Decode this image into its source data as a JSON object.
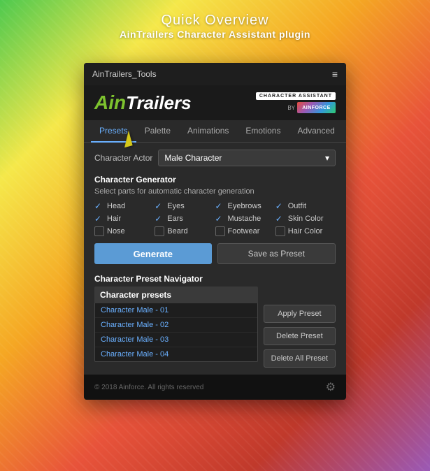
{
  "page": {
    "title": "Quick Overview",
    "subtitle": "AinTrailers Character Assistant plugin"
  },
  "titlebar": {
    "text": "AinTrailers_Tools",
    "menu_icon": "≡"
  },
  "logo": {
    "ain": "Ain",
    "trailers": "Trailers",
    "badge": "CHARACTER ASSISTANT",
    "by": "BY",
    "ainforce": "AINFORCE"
  },
  "nav": {
    "tabs": [
      {
        "label": "Presets",
        "active": true
      },
      {
        "label": "Palette",
        "active": false
      },
      {
        "label": "Animations",
        "active": false
      },
      {
        "label": "Emotions",
        "active": false
      },
      {
        "label": "Advanced",
        "active": false
      }
    ]
  },
  "char_actor": {
    "label": "Character Actor",
    "value": "Male Character",
    "dropdown_icon": "▾"
  },
  "generator": {
    "title": "Character Generator",
    "desc": "Select parts for automatic character generation",
    "checkboxes": [
      {
        "label": "Head",
        "checked": true
      },
      {
        "label": "Eyes",
        "checked": true
      },
      {
        "label": "Eyebrows",
        "checked": true
      },
      {
        "label": "Outfit",
        "checked": true
      },
      {
        "label": "Hair",
        "checked": true
      },
      {
        "label": "Ears",
        "checked": true
      },
      {
        "label": "Mustache",
        "checked": true
      },
      {
        "label": "Skin Color",
        "checked": true
      },
      {
        "label": "Nose",
        "checked": false
      },
      {
        "label": "Beard",
        "checked": false
      },
      {
        "label": "Footwear",
        "checked": false
      },
      {
        "label": "Hair Color",
        "checked": false
      }
    ],
    "btn_generate": "Generate",
    "btn_save": "Save as Preset"
  },
  "preset_nav": {
    "title": "Character Preset Navigator",
    "list_header": "Character presets",
    "items": [
      {
        "label": "Character Male - 01"
      },
      {
        "label": "Character Male - 02"
      },
      {
        "label": "Character Male - 03"
      },
      {
        "label": "Character Male - 04"
      }
    ],
    "btn_apply": "Apply Preset",
    "btn_delete": "Delete Preset",
    "btn_delete_all": "Delete All Preset"
  },
  "footer": {
    "copyright": "© 2018 Ainforce. All rights reserved",
    "gear_icon": "⚙"
  }
}
